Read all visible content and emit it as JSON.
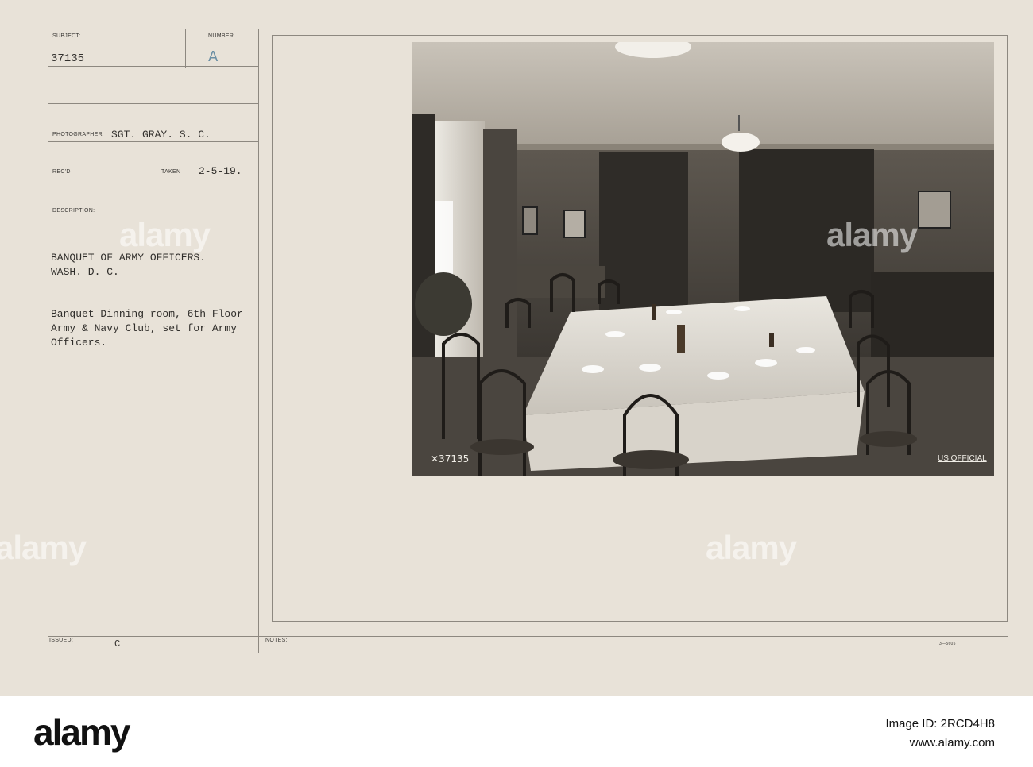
{
  "card": {
    "subject_label": "SUBJECT:",
    "number_label": "NUMBER",
    "subject_value": "37135",
    "number_value": "A",
    "photographer_label": "PHOTOGRAPHER",
    "photographer_value": "SGT. GRAY. S. C.",
    "recd_label": "REC'D",
    "taken_label": "TAKEN",
    "taken_value": "2-5-19.",
    "description_label": "DESCRIPTION:",
    "description_lines": [
      "BANQUET OF ARMY OFFICERS.",
      "WASH. D. C.",
      "",
      "Banquet Dinning room, 6th Floor",
      "Army & Navy Club, set for Army",
      "Officers."
    ],
    "issued_label": "ISSUED:",
    "issued_value": "C",
    "notes_label": "NOTES:",
    "form_code": "3—5605"
  },
  "photo": {
    "negative_number": "✕37135",
    "official_stamp": "US OFFICIAL"
  },
  "watermark": {
    "text": "alamy"
  },
  "footer": {
    "brand": "alamy",
    "image_id_line": "Image ID: 2RCD4H8",
    "site_line": "www.alamy.com"
  }
}
